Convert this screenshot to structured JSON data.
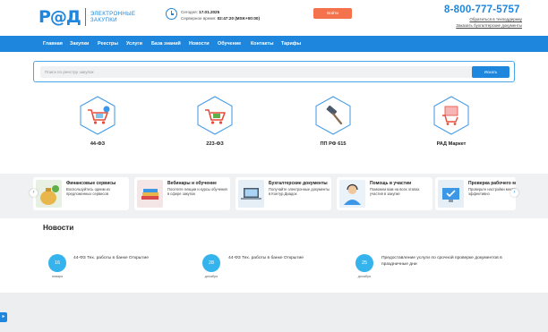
{
  "header": {
    "logo_mark": "Р@Д",
    "logo_line1": "ЭЛЕКТРОННЫЕ",
    "logo_line2": "ЗАКУПКИ",
    "today_label": "Сегодня:",
    "today_value": "17.01.2025",
    "server_time_label": "Серверное время:",
    "server_time_value": "02:47:20 (MSK+00:00)",
    "login_label": "Войти",
    "phone": "8-800-777-5757",
    "link_callback": "Обратиться в техподдержку",
    "link_order": "Заказать бухгалтерские документы"
  },
  "nav": {
    "items": [
      "Главная",
      "Закупки",
      "Реестры",
      "Услуги",
      "База знаний",
      "Новости",
      "Обучение",
      "Контакты",
      "Тарифы"
    ]
  },
  "search": {
    "placeholder": "Поиск по реестру закупок",
    "button_label": "Искать"
  },
  "categories": [
    {
      "label": "44-ФЗ",
      "icon": "cart-icon"
    },
    {
      "label": "223-ФЗ",
      "icon": "cart-icon"
    },
    {
      "label": "ПП РФ 615",
      "icon": "hammer-icon"
    },
    {
      "label": "РАД Маркет",
      "icon": "shop-cart-icon"
    }
  ],
  "services": [
    {
      "title": "Финансовые сервисы",
      "desc": "Воспользуйтесь одним из предложенных сервисов"
    },
    {
      "title": "Вебинары и обучение",
      "desc": "Посетите лекции и курсы обучения в сфере закупок"
    },
    {
      "title": "Бухгалтерские документы",
      "desc": "Получайте электронные документы в Контур.Диадок"
    },
    {
      "title": "Помощь в участии",
      "desc": "Поможем вам на всех этапах участия в закупке"
    },
    {
      "title": "Проверка рабочего м",
      "desc": "Проверьте настройки места для эффективно"
    }
  ],
  "news": {
    "title": "Новости",
    "items": [
      {
        "day": "16",
        "month": "января",
        "text": "44-ФЗ Тех. работы в банке Открытие"
      },
      {
        "day": "28",
        "month": "декабря",
        "text": "44-ФЗ Тех. работы в банке Открытие"
      },
      {
        "day": "25",
        "month": "декабря",
        "text": "Предоставление услуги по срочной проверке документов в праздничные дни"
      }
    ]
  },
  "colors": {
    "brand": "#1e86dc",
    "accent": "#f4734c",
    "news_circle": "#34b3ec"
  }
}
